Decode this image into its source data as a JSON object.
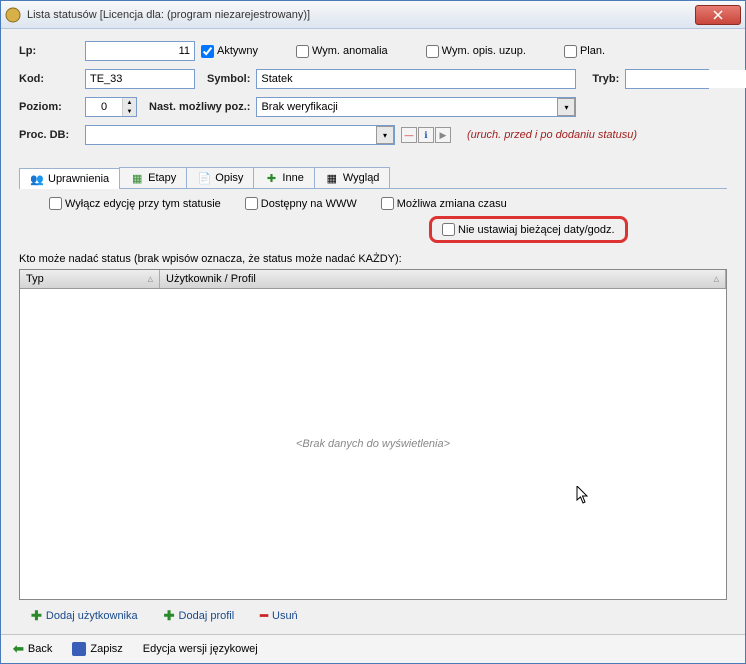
{
  "title": "Lista statusów  [Licencja dla: (program niezarejestrowany)]",
  "labels": {
    "lp": "Lp:",
    "kod": "Kod:",
    "symbol": "Symbol:",
    "tryb": "Tryb:",
    "poziom": "Poziom:",
    "nast_mozliwy": "Nast. możliwy poz.:",
    "proc_db": "Proc. DB:"
  },
  "fields": {
    "lp": "11",
    "kod": "TE_33",
    "symbol": "Statek",
    "tryb": "",
    "poziom": "0",
    "nast_mozliwy": "Brak weryfikacji",
    "proc_db": ""
  },
  "checks": {
    "aktywny": "Aktywny",
    "wym_anomalia": "Wym. anomalia",
    "wym_opis": "Wym. opis. uzup.",
    "plan": "Plan.",
    "wylacz_edycje": "Wyłącz edycję przy tym statusie",
    "dostepny_www": "Dostępny na WWW",
    "mozliwa_zmiana": "Możliwa zmiana czasu",
    "nie_ustawiaj": "Nie ustawiaj bieżącej daty/godz."
  },
  "proc_note": "(uruch. przed i po dodaniu statusu)",
  "tabs": {
    "uprawnienia": "Uprawnienia",
    "etapy": "Etapy",
    "opisy": "Opisy",
    "inne": "Inne",
    "wyglad": "Wygląd"
  },
  "table": {
    "subtitle": "Kto może nadać status (brak wpisów oznacza, że status może nadać KAŻDY):",
    "col_typ": "Typ",
    "col_user": "Użytkownik / Profil",
    "empty": "<Brak danych do wyświetlenia>"
  },
  "actions": {
    "dodaj_uzytkownika": "Dodaj użytkownika",
    "dodaj_profil": "Dodaj profil",
    "usun": "Usuń"
  },
  "footer": {
    "back": "Back",
    "zapisz": "Zapisz",
    "edycja": "Edycja wersji językowej"
  }
}
